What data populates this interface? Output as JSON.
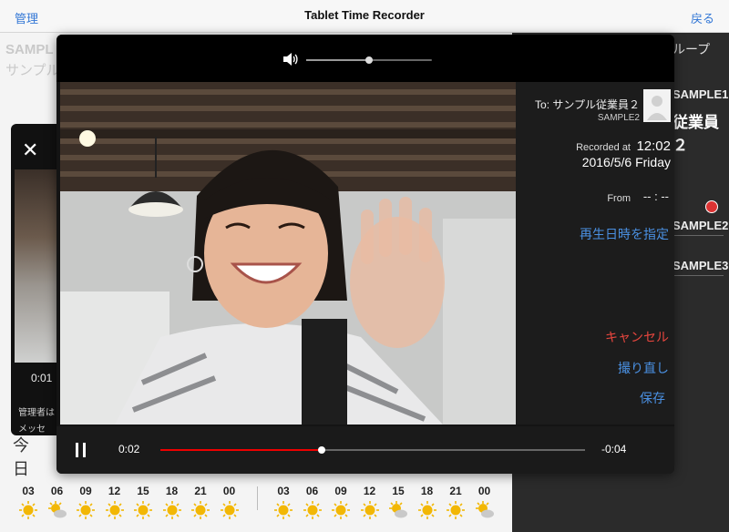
{
  "nav": {
    "left": "管理",
    "title": "Tablet Time Recorder",
    "right": "戻る"
  },
  "background": {
    "sample_en": "SAMPL",
    "sample_jp": "サンプル",
    "group_label": "ループ",
    "items": [
      "SAMPLE1",
      "SAMPLE2",
      "SAMPLE3"
    ],
    "big_name": "従業員２",
    "today": [
      "今",
      "日"
    ]
  },
  "back_card": {
    "time": "0:01",
    "text1": "管理者は",
    "text2": "メッセ"
  },
  "weather": {
    "day1": [
      {
        "hour": "03",
        "icon": "sun-icon"
      },
      {
        "hour": "06",
        "icon": "partly-cloudy-icon"
      },
      {
        "hour": "09",
        "icon": "sun-icon"
      },
      {
        "hour": "12",
        "icon": "sun-icon"
      },
      {
        "hour": "15",
        "icon": "sun-icon"
      },
      {
        "hour": "18",
        "icon": "sun-icon"
      },
      {
        "hour": "21",
        "icon": "sun-icon"
      },
      {
        "hour": "00",
        "icon": "sun-icon"
      }
    ],
    "day2": [
      {
        "hour": "03",
        "icon": "sun-icon"
      },
      {
        "hour": "06",
        "icon": "sun-icon"
      },
      {
        "hour": "09",
        "icon": "sun-icon"
      },
      {
        "hour": "12",
        "icon": "sun-icon"
      },
      {
        "hour": "15",
        "icon": "partly-cloudy-icon"
      },
      {
        "hour": "18",
        "icon": "sun-icon"
      },
      {
        "hour": "21",
        "icon": "sun-icon"
      },
      {
        "hour": "00",
        "icon": "partly-cloudy-icon"
      }
    ]
  },
  "modal": {
    "volume_fraction": 0.5,
    "to": "To: サンプル従業員２",
    "to_sub": "SAMPLE2",
    "recorded_label": "Recorded at",
    "recorded_time": "12:02",
    "recorded_date": "2016/5/6 Friday",
    "from_label": "From",
    "from_value": "-- : --",
    "set_time": "再生日時を指定",
    "cancel": "キャンセル",
    "retake": "撮り直し",
    "save": "保存",
    "current_time": "0:02",
    "remaining_time": "-0:04",
    "progress_fraction": 0.38
  },
  "colors": {
    "accent": "#3478d6",
    "cancel": "#e8463e",
    "seek": "#e00000"
  }
}
